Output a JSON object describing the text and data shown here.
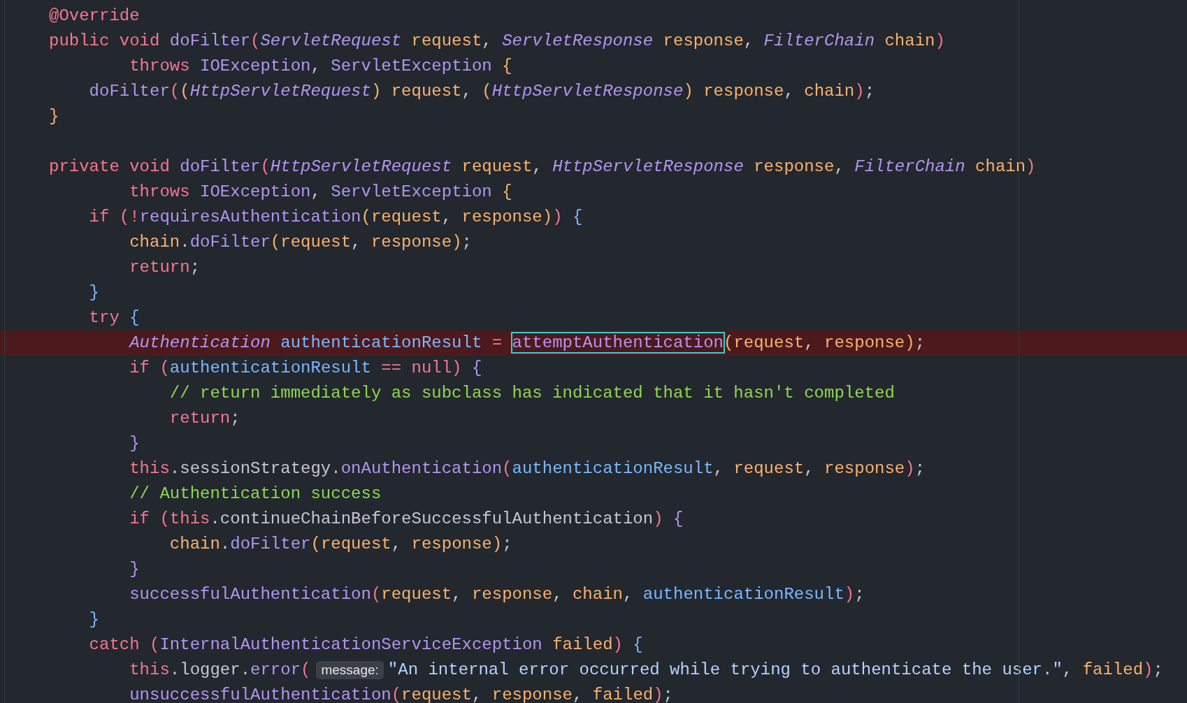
{
  "editor": {
    "lines": [
      {
        "highlighted": false,
        "tokens": [
          {
            "kind": "keyword",
            "text": "@Override"
          }
        ]
      },
      {
        "highlighted": false,
        "tokens": [
          {
            "kind": "keyword",
            "text": "public void "
          },
          {
            "kind": "method",
            "text": "doFilter"
          },
          {
            "kind": "paren",
            "text": "("
          },
          {
            "kind": "type",
            "text": "ServletRequest"
          },
          {
            "kind": "param",
            "text": " request"
          },
          {
            "kind": "text",
            "text": ", "
          },
          {
            "kind": "type",
            "text": "ServletResponse"
          },
          {
            "kind": "param",
            "text": " response"
          },
          {
            "kind": "text",
            "text": ", "
          },
          {
            "kind": "type",
            "text": "FilterChain"
          },
          {
            "kind": "param",
            "text": " chain"
          },
          {
            "kind": "paren",
            "text": ")"
          }
        ]
      },
      {
        "highlighted": false,
        "tokens": [
          {
            "kind": "keyword",
            "text": "        throws "
          },
          {
            "kind": "method",
            "text": "IOException"
          },
          {
            "kind": "text",
            "text": ", "
          },
          {
            "kind": "method",
            "text": "ServletException"
          },
          {
            "kind": "brace",
            "text": " {"
          }
        ]
      },
      {
        "highlighted": false,
        "tokens": [
          {
            "kind": "method",
            "text": "    doFilter"
          },
          {
            "kind": "paren",
            "text": "("
          },
          {
            "kind": "brace",
            "text": "("
          },
          {
            "kind": "type",
            "text": "HttpServletRequest"
          },
          {
            "kind": "brace",
            "text": ")"
          },
          {
            "kind": "param",
            "text": " request"
          },
          {
            "kind": "text",
            "text": ", "
          },
          {
            "kind": "brace",
            "text": "("
          },
          {
            "kind": "type",
            "text": "HttpServletResponse"
          },
          {
            "kind": "brace",
            "text": ")"
          },
          {
            "kind": "param",
            "text": " response"
          },
          {
            "kind": "text",
            "text": ", "
          },
          {
            "kind": "param",
            "text": "chain"
          },
          {
            "kind": "paren",
            "text": ")"
          },
          {
            "kind": "text",
            "text": ";"
          }
        ]
      },
      {
        "highlighted": false,
        "tokens": [
          {
            "kind": "brace",
            "text": "}"
          }
        ]
      },
      {
        "highlighted": false
      },
      {
        "highlighted": false,
        "tokens": [
          {
            "kind": "keyword",
            "text": "private void "
          },
          {
            "kind": "method",
            "text": "doFilter"
          },
          {
            "kind": "paren",
            "text": "("
          },
          {
            "kind": "type",
            "text": "HttpServletRequest"
          },
          {
            "kind": "param",
            "text": " request"
          },
          {
            "kind": "text",
            "text": ", "
          },
          {
            "kind": "type",
            "text": "HttpServletResponse"
          },
          {
            "kind": "param",
            "text": " response"
          },
          {
            "kind": "text",
            "text": ", "
          },
          {
            "kind": "type",
            "text": "FilterChain"
          },
          {
            "kind": "param",
            "text": " chain"
          },
          {
            "kind": "paren",
            "text": ")"
          }
        ]
      },
      {
        "highlighted": false,
        "tokens": [
          {
            "kind": "keyword",
            "text": "        throws "
          },
          {
            "kind": "method",
            "text": "IOException"
          },
          {
            "kind": "text",
            "text": ", "
          },
          {
            "kind": "method",
            "text": "ServletException"
          },
          {
            "kind": "brace",
            "text": " {"
          }
        ]
      },
      {
        "highlighted": false,
        "tokens": [
          {
            "kind": "keyword",
            "text": "    if "
          },
          {
            "kind": "paren",
            "text": "("
          },
          {
            "kind": "keyword",
            "text": "!"
          },
          {
            "kind": "method",
            "text": "requiresAuthentication"
          },
          {
            "kind": "brace",
            "text": "("
          },
          {
            "kind": "param",
            "text": "request"
          },
          {
            "kind": "text",
            "text": ", "
          },
          {
            "kind": "param",
            "text": "response"
          },
          {
            "kind": "brace",
            "text": ")"
          },
          {
            "kind": "paren",
            "text": ")"
          },
          {
            "kind": "bluebrace",
            "text": " {"
          }
        ]
      },
      {
        "highlighted": false,
        "tokens": [
          {
            "kind": "param",
            "text": "        chain"
          },
          {
            "kind": "text",
            "text": "."
          },
          {
            "kind": "method",
            "text": "doFilter"
          },
          {
            "kind": "brace",
            "text": "("
          },
          {
            "kind": "param",
            "text": "request"
          },
          {
            "kind": "text",
            "text": ", "
          },
          {
            "kind": "param",
            "text": "response"
          },
          {
            "kind": "brace",
            "text": ")"
          },
          {
            "kind": "text",
            "text": ";"
          }
        ]
      },
      {
        "highlighted": false,
        "tokens": [
          {
            "kind": "keyword",
            "text": "        return"
          },
          {
            "kind": "text",
            "text": ";"
          }
        ]
      },
      {
        "highlighted": false,
        "tokens": [
          {
            "kind": "bluebrace",
            "text": "    }"
          }
        ]
      },
      {
        "highlighted": false,
        "tokens": [
          {
            "kind": "keyword",
            "text": "    try "
          },
          {
            "kind": "bluebrace",
            "text": "{"
          }
        ]
      },
      {
        "highlighted": true,
        "tokens": [
          {
            "kind": "type",
            "text": "        Authentication"
          },
          {
            "kind": "variable",
            "text": " authenticationResult"
          },
          {
            "kind": "keyword",
            "text": " = "
          },
          {
            "kind": "boxed",
            "text": "attemptAuthentication"
          },
          {
            "kind": "brace",
            "text": "("
          },
          {
            "kind": "param",
            "text": "request"
          },
          {
            "kind": "text",
            "text": ", "
          },
          {
            "kind": "param",
            "text": "response"
          },
          {
            "kind": "brace",
            "text": ")"
          },
          {
            "kind": "text",
            "text": ";"
          }
        ]
      },
      {
        "highlighted": false,
        "tokens": [
          {
            "kind": "keyword",
            "text": "        if "
          },
          {
            "kind": "paren",
            "text": "("
          },
          {
            "kind": "variable",
            "text": "authenticationResult"
          },
          {
            "kind": "keyword",
            "text": " == null"
          },
          {
            "kind": "paren",
            "text": ")"
          },
          {
            "kind": "purplebrace",
            "text": " {"
          }
        ]
      },
      {
        "highlighted": false,
        "tokens": [
          {
            "kind": "comment",
            "text": "            // return immediately as subclass has indicated that it hasn't completed"
          }
        ]
      },
      {
        "highlighted": false,
        "tokens": [
          {
            "kind": "keyword",
            "text": "            return"
          },
          {
            "kind": "text",
            "text": ";"
          }
        ]
      },
      {
        "highlighted": false,
        "tokens": [
          {
            "kind": "purplebrace",
            "text": "        }"
          }
        ]
      },
      {
        "highlighted": false,
        "tokens": [
          {
            "kind": "keyword",
            "text": "        this"
          },
          {
            "kind": "text",
            "text": ".sessionStrategy."
          },
          {
            "kind": "method",
            "text": "onAuthentication"
          },
          {
            "kind": "paren",
            "text": "("
          },
          {
            "kind": "variable",
            "text": "authenticationResult"
          },
          {
            "kind": "text",
            "text": ", "
          },
          {
            "kind": "param",
            "text": "request"
          },
          {
            "kind": "text",
            "text": ", "
          },
          {
            "kind": "param",
            "text": "response"
          },
          {
            "kind": "paren",
            "text": ")"
          },
          {
            "kind": "text",
            "text": ";"
          }
        ]
      },
      {
        "highlighted": false,
        "tokens": [
          {
            "kind": "comment",
            "text": "        // Authentication success"
          }
        ]
      },
      {
        "highlighted": false,
        "tokens": [
          {
            "kind": "keyword",
            "text": "        if "
          },
          {
            "kind": "paren",
            "text": "("
          },
          {
            "kind": "keyword",
            "text": "this"
          },
          {
            "kind": "text",
            "text": ".continueChainBeforeSuccessfulAuthentication"
          },
          {
            "kind": "paren",
            "text": ")"
          },
          {
            "kind": "purplebrace",
            "text": " {"
          }
        ]
      },
      {
        "highlighted": false,
        "tokens": [
          {
            "kind": "param",
            "text": "            chain"
          },
          {
            "kind": "text",
            "text": "."
          },
          {
            "kind": "method",
            "text": "doFilter"
          },
          {
            "kind": "brace",
            "text": "("
          },
          {
            "kind": "param",
            "text": "request"
          },
          {
            "kind": "text",
            "text": ", "
          },
          {
            "kind": "param",
            "text": "response"
          },
          {
            "kind": "brace",
            "text": ")"
          },
          {
            "kind": "text",
            "text": ";"
          }
        ]
      },
      {
        "highlighted": false,
        "tokens": [
          {
            "kind": "purplebrace",
            "text": "        }"
          }
        ]
      },
      {
        "highlighted": false,
        "tokens": [
          {
            "kind": "method",
            "text": "        successfulAuthentication"
          },
          {
            "kind": "paren",
            "text": "("
          },
          {
            "kind": "param",
            "text": "request"
          },
          {
            "kind": "text",
            "text": ", "
          },
          {
            "kind": "param",
            "text": "response"
          },
          {
            "kind": "text",
            "text": ", "
          },
          {
            "kind": "param",
            "text": "chain"
          },
          {
            "kind": "text",
            "text": ", "
          },
          {
            "kind": "variable",
            "text": "authenticationResult"
          },
          {
            "kind": "paren",
            "text": ")"
          },
          {
            "kind": "text",
            "text": ";"
          }
        ]
      },
      {
        "highlighted": false,
        "tokens": [
          {
            "kind": "bluebrace",
            "text": "    }"
          }
        ]
      },
      {
        "highlighted": false,
        "tokens": [
          {
            "kind": "keyword",
            "text": "    catch "
          },
          {
            "kind": "paren",
            "text": "("
          },
          {
            "kind": "method",
            "text": "InternalAuthenticationServiceException"
          },
          {
            "kind": "param",
            "text": " failed"
          },
          {
            "kind": "paren",
            "text": ")"
          },
          {
            "kind": "bluebrace",
            "text": " {"
          }
        ]
      },
      {
        "highlighted": false,
        "tokens": [
          {
            "kind": "keyword",
            "text": "        this"
          },
          {
            "kind": "text",
            "text": ".logger."
          },
          {
            "kind": "method",
            "text": "error"
          },
          {
            "kind": "paren",
            "text": "("
          },
          {
            "kind": "hint",
            "text": "message:"
          },
          {
            "kind": "string",
            "text": "\"An internal error occurred while trying to authenticate the user.\""
          },
          {
            "kind": "text",
            "text": ", "
          },
          {
            "kind": "param",
            "text": "failed"
          },
          {
            "kind": "paren",
            "text": ")"
          },
          {
            "kind": "text",
            "text": ";"
          }
        ]
      },
      {
        "highlighted": false,
        "tokens": [
          {
            "kind": "method",
            "text": "        unsuccessfulAuthentication"
          },
          {
            "kind": "paren",
            "text": "("
          },
          {
            "kind": "param",
            "text": "request"
          },
          {
            "kind": "text",
            "text": ", "
          },
          {
            "kind": "param",
            "text": "response"
          },
          {
            "kind": "text",
            "text": ", "
          },
          {
            "kind": "param",
            "text": "failed"
          },
          {
            "kind": "paren",
            "text": ")"
          },
          {
            "kind": "text",
            "text": ";"
          }
        ]
      }
    ]
  }
}
